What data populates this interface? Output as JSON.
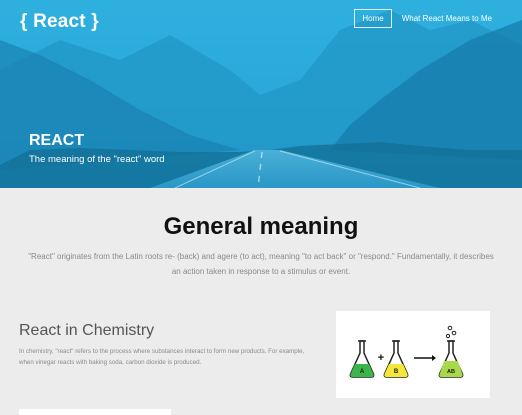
{
  "header": {
    "logo": "{ React }",
    "nav": [
      "Home",
      "What React Means to Me"
    ]
  },
  "hero": {
    "title": "REACT",
    "subtitle": "The meaning of the \"react\" word"
  },
  "general": {
    "heading": "General meaning",
    "body": "\"React\" originates from the Latin roots re- (back) and agere (to act), meaning \"to act back\" or \"respond.\" Fundamentally, it describes an action taken in response to a stimulus or event."
  },
  "chemistry": {
    "heading": "React in Chemistry",
    "body": "In chemistry, \"react\" refers to the process where substances interact to form new products. For example, when vinegar reacts with baking soda, carbon dioxide is produced.",
    "figure": {
      "flask_a": "A",
      "flask_b": "B",
      "flask_ab": "AB",
      "plus": "+",
      "colors": {
        "a": "#3bb54a",
        "b": "#f5e63a",
        "ab": "#a8d94a"
      }
    }
  }
}
